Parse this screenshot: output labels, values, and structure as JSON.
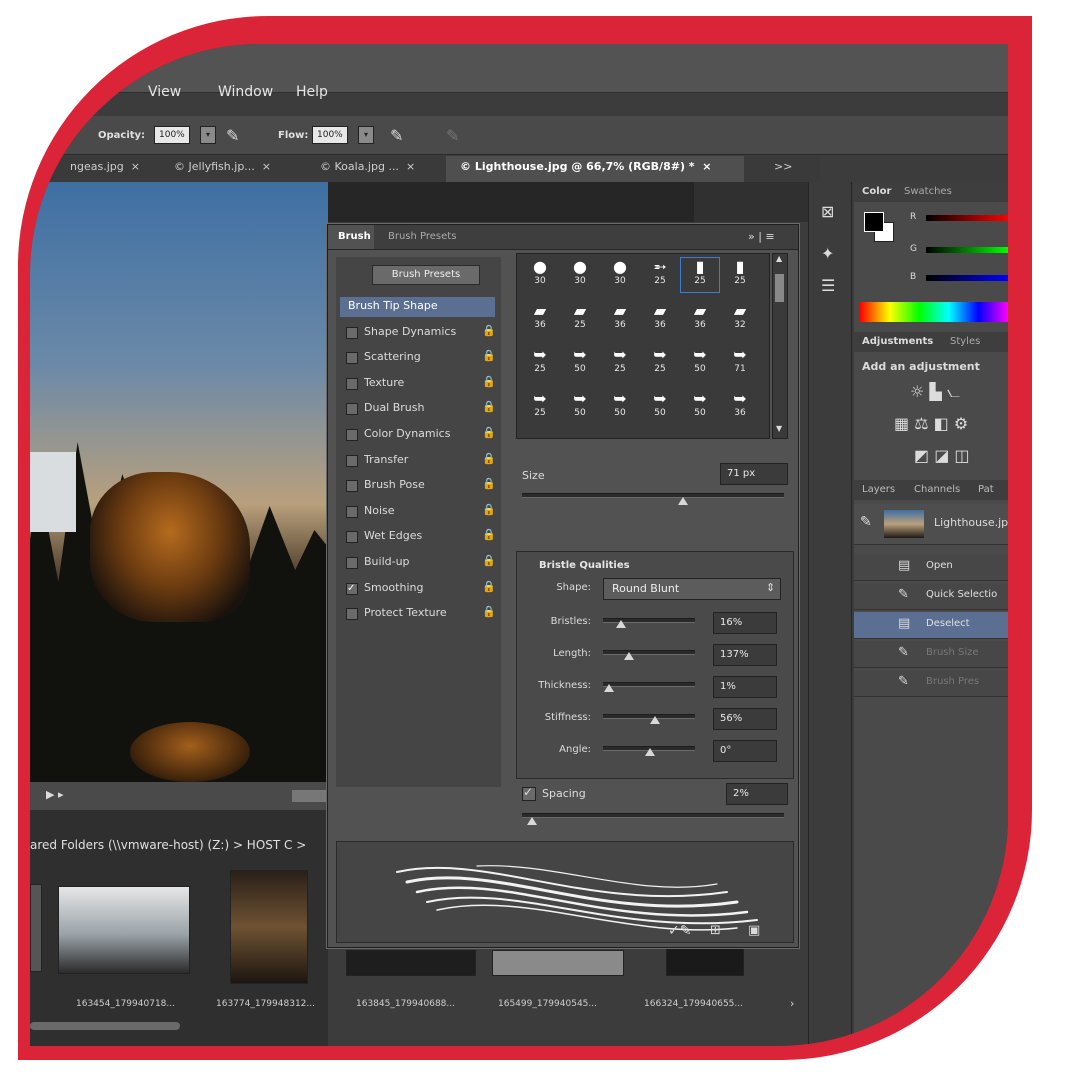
{
  "menu": {
    "items": [
      "View",
      "Window",
      "Help"
    ]
  },
  "options": {
    "opacity_label": "Opacity:",
    "opacity_value": "100%",
    "flow_label": "Flow:",
    "flow_value": "100%"
  },
  "doc_tabs": [
    {
      "label": "ngeas.jpg",
      "close": "×"
    },
    {
      "label": "© Jellyfish.jp...",
      "close": "×"
    },
    {
      "label": "© Koala.jpg ...",
      "close": "×"
    },
    {
      "label": "© Lighthouse.jpg @ 66,7% (RGB/8#) *",
      "close": "×"
    }
  ],
  "tabs_overflow": ">>",
  "brush_panel": {
    "tabs": [
      "Brush",
      "Brush Presets"
    ],
    "presets_button": "Brush Presets",
    "options": [
      {
        "label": "Brush Tip Shape",
        "checked": false,
        "selected": true,
        "lock": ""
      },
      {
        "label": "Shape Dynamics",
        "checked": false,
        "lock": "🔒"
      },
      {
        "label": "Scattering",
        "checked": false,
        "lock": "🔒"
      },
      {
        "label": "Texture",
        "checked": false,
        "lock": "🔒"
      },
      {
        "label": "Dual Brush",
        "checked": false,
        "lock": "🔒"
      },
      {
        "label": "Color Dynamics",
        "checked": false,
        "lock": "🔒"
      },
      {
        "label": "Transfer",
        "checked": false,
        "lock": "🔒"
      },
      {
        "label": "Brush Pose",
        "checked": false,
        "lock": "🔒"
      },
      {
        "label": "Noise",
        "checked": false,
        "lock": "🔒"
      },
      {
        "label": "Wet Edges",
        "checked": false,
        "lock": "🔒"
      },
      {
        "label": "Build-up",
        "checked": false,
        "lock": "🔒"
      },
      {
        "label": "Smoothing",
        "checked": true,
        "lock": "🔒"
      },
      {
        "label": "Protect Texture",
        "checked": false,
        "lock": "🔒"
      }
    ],
    "tips": [
      {
        "glyph": "●",
        "size": "30"
      },
      {
        "glyph": "●",
        "size": "30"
      },
      {
        "glyph": "●",
        "size": "30"
      },
      {
        "glyph": "➵",
        "size": "25"
      },
      {
        "glyph": "▮",
        "size": "25"
      },
      {
        "glyph": "▮",
        "size": "25"
      },
      {
        "glyph": "▰",
        "size": "36"
      },
      {
        "glyph": "▰",
        "size": "25"
      },
      {
        "glyph": "▰",
        "size": "36"
      },
      {
        "glyph": "▰",
        "size": "36"
      },
      {
        "glyph": "▰",
        "size": "36"
      },
      {
        "glyph": "▰",
        "size": "32"
      },
      {
        "glyph": "➥",
        "size": "25"
      },
      {
        "glyph": "➥",
        "size": "50"
      },
      {
        "glyph": "➥",
        "size": "25"
      },
      {
        "glyph": "➥",
        "size": "25"
      },
      {
        "glyph": "➥",
        "size": "50"
      },
      {
        "glyph": "➥",
        "size": "71"
      },
      {
        "glyph": "➥",
        "size": "25"
      },
      {
        "glyph": "➥",
        "size": "50"
      },
      {
        "glyph": "➥",
        "size": "50"
      },
      {
        "glyph": "➥",
        "size": "50"
      },
      {
        "glyph": "➥",
        "size": "50"
      },
      {
        "glyph": "➥",
        "size": "36"
      }
    ],
    "size_label": "Size",
    "size_value": "71 px",
    "size_level": 0.62,
    "bristle_title": "Bristle Qualities",
    "shape_label": "Shape:",
    "shape_value": "Round Blunt",
    "bristle_rows": [
      {
        "label": "Bristles:",
        "value": "16%",
        "level": 0.16
      },
      {
        "label": "Length:",
        "value": "137%",
        "level": 0.25
      },
      {
        "label": "Thickness:",
        "value": "1%",
        "level": 0.01
      },
      {
        "label": "Stiffness:",
        "value": "56%",
        "level": 0.56
      },
      {
        "label": "Angle:",
        "value": "0°",
        "level": 0.5
      }
    ],
    "spacing_label": "Spacing",
    "spacing_value": "2%",
    "spacing_level": 0.02
  },
  "right_panel": {
    "color_tabs": [
      "Color",
      "Swatches"
    ],
    "channels": [
      "R",
      "G",
      "B"
    ],
    "adj_tabs": [
      "Adjustments",
      "Styles"
    ],
    "adj_title": "Add an adjustment",
    "layer_tabs": [
      "Layers",
      "Channels",
      "Pat"
    ],
    "layer_name": "Lighthouse.jp",
    "history": [
      {
        "label": "Open",
        "state": "normal"
      },
      {
        "label": "Quick Selectio",
        "state": "normal"
      },
      {
        "label": "Deselect",
        "state": "selected"
      },
      {
        "label": "Brush Size",
        "state": "dim"
      },
      {
        "label": "Brush Pres",
        "state": "dim"
      }
    ]
  },
  "bridge": {
    "path": "ared Folders (\\\\vmware-host) (Z:) > HOST C >",
    "thumbs": [
      "163454_179940718...",
      "163774_179948312...",
      "163845_179940688...",
      "165499_179940545...",
      "166324_179940655..."
    ]
  },
  "colors": {
    "frame": "#dc2438",
    "panel": "#525252",
    "selected": "#5a6f92"
  }
}
